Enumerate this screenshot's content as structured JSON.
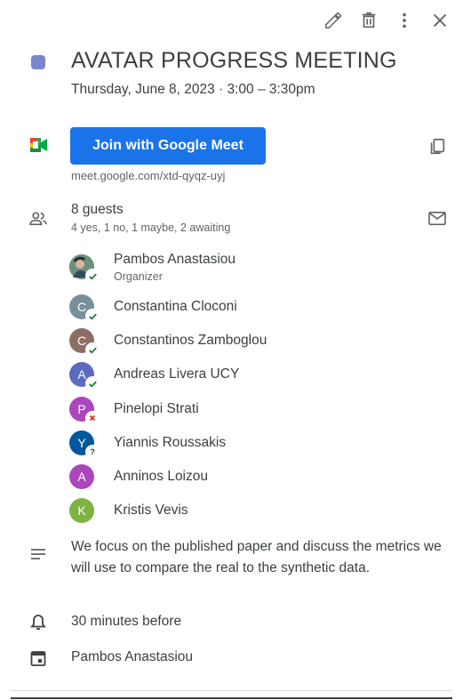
{
  "toolbar": {
    "edit_icon": "pencil-icon",
    "delete_icon": "trash-icon",
    "more_icon": "more-vert-icon",
    "close_icon": "close-icon"
  },
  "event": {
    "color": "#7986cb",
    "title": "AVATAR PROGRESS MEETING",
    "datetime": "Thursday, June 8, 2023  ·  3:00 – 3:30pm"
  },
  "meet": {
    "button_label": "Join with Google Meet",
    "link": "meet.google.com/xtd-qyqz-uyj",
    "accent": "#1a73e8"
  },
  "guests": {
    "count_label": "8 guests",
    "summary": "4 yes, 1 no, 1 maybe, 2 awaiting",
    "list": [
      {
        "name": "Pambos Anastasiou",
        "role": "Organizer",
        "initial": "",
        "color": "#5d7a6a",
        "status": "yes"
      },
      {
        "name": "Constantina Cloconi",
        "role": "",
        "initial": "C",
        "color": "#78909c",
        "status": "yes"
      },
      {
        "name": "Constantinos Zamboglou",
        "role": "",
        "initial": "C",
        "color": "#8d6e63",
        "status": "yes"
      },
      {
        "name": "Andreas Livera UCY",
        "role": "",
        "initial": "A",
        "color": "#5c6bc0",
        "status": "yes"
      },
      {
        "name": "Pinelopi Strati",
        "role": "",
        "initial": "P",
        "color": "#ab47bc",
        "status": "no"
      },
      {
        "name": "Yiannis Roussakis",
        "role": "",
        "initial": "Y",
        "color": "#01579b",
        "status": "maybe"
      },
      {
        "name": "Anninos Loizou",
        "role": "",
        "initial": "A",
        "color": "#ab47bc",
        "status": "awaiting"
      },
      {
        "name": "Kristis Vevis",
        "role": "",
        "initial": "K",
        "color": "#7cb342",
        "status": "awaiting"
      }
    ]
  },
  "description": "We focus on the published paper and discuss the metrics we will use to compare the real to the synthetic data.",
  "reminder": "30 minutes before",
  "calendar_owner": "Pambos Anastasiou",
  "status_colors": {
    "yes": "#188038",
    "no": "#d93025",
    "maybe": "#3c4043"
  }
}
